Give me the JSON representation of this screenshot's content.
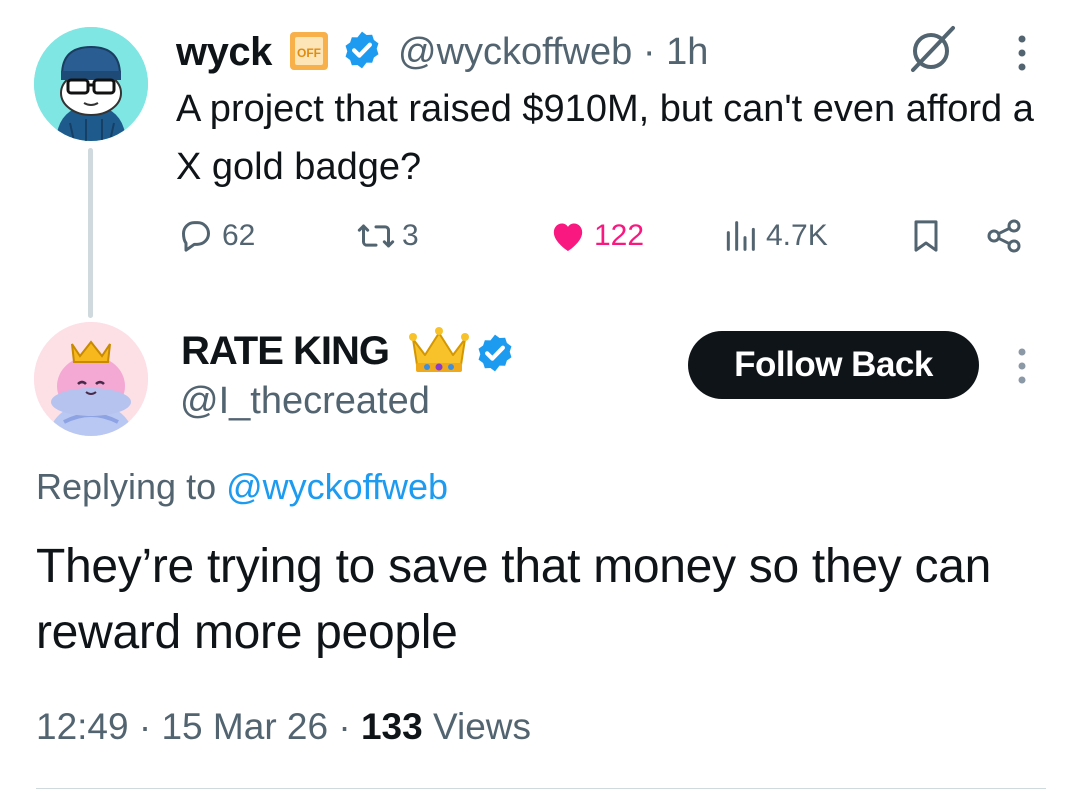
{
  "parent": {
    "name": "wyck",
    "handle": "@wyckoffweb",
    "separator": "·",
    "time": "1h",
    "off_badge": "OFF",
    "text": "A project that raised $910M, but can't even afford a X gold badge?",
    "stats": {
      "replies": "62",
      "reposts": "3",
      "likes": "122",
      "views": "4.7K"
    },
    "icons": [
      "grok-icon",
      "more-icon",
      "reply-icon",
      "repost-icon",
      "like-icon",
      "views-icon",
      "bookmark-icon",
      "share-icon",
      "verified-icon"
    ]
  },
  "reply": {
    "name": "RATE KING",
    "handle": "@I_thecreated",
    "follow_label": "Follow Back",
    "replying_prefix": "Replying to ",
    "replying_handle": "@wyckoffweb",
    "text": "They’re trying to save that money so they can reward more people",
    "time": "12:49",
    "date": "15 Mar 26",
    "views_count": "133",
    "views_label": " Views",
    "dot": " · "
  },
  "colors": {
    "verified": "#1d9bf0",
    "like": "#f91880",
    "muted": "#536471",
    "text": "#0f1419",
    "link": "#1d9bf0"
  }
}
